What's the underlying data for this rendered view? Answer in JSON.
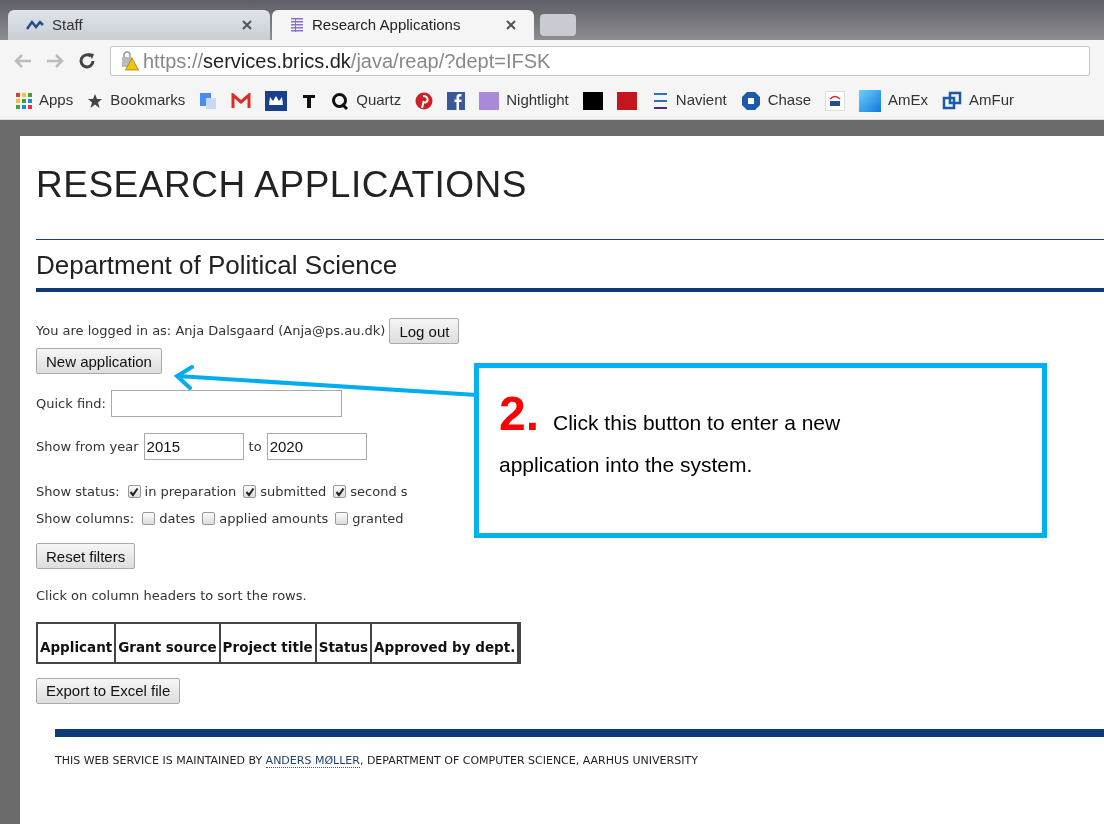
{
  "browser": {
    "tabs": [
      {
        "title": "Staff",
        "selected": false,
        "kind": "wave"
      },
      {
        "title": "Research Applications",
        "selected": true,
        "kind": "grid"
      }
    ],
    "url": {
      "scheme": "https://",
      "host": "services.brics.dk",
      "path": "/java/reap/?dept=IFSK"
    },
    "bookmarks": [
      {
        "label": "Apps",
        "kind": "apps"
      },
      {
        "label": "Bookmarks",
        "kind": "star"
      },
      {
        "kind": "translate"
      },
      {
        "kind": "mail"
      },
      {
        "kind": "crown"
      },
      {
        "kind": "newspaper"
      },
      {
        "label": "Quartz",
        "kind": "q"
      },
      {
        "kind": "pin"
      },
      {
        "kind": "facebook"
      },
      {
        "label": "Nightlight",
        "kind": "purple"
      },
      {
        "kind": "black"
      },
      {
        "kind": "red"
      },
      {
        "label": "Navient",
        "kind": "lines"
      },
      {
        "label": "Chase",
        "kind": "octagon"
      },
      {
        "kind": "white"
      },
      {
        "label": "AmEx",
        "kind": "blue"
      },
      {
        "label": "AmFur",
        "kind": "squares"
      }
    ]
  },
  "page": {
    "title": "RESEARCH APPLICATIONS",
    "subtitle": "Department of Political Science",
    "login_text": "You are logged in as: Anja Dalsgaard (Anja@ps.au.dk)",
    "logout_button": "Log out",
    "new_button": "New application",
    "quick_find": {
      "label": "Quick find:"
    },
    "year_from": {
      "label": "Show from year",
      "value": "2015"
    },
    "year_to": {
      "label": "to",
      "value": "2020"
    },
    "status": {
      "label": "Show status:",
      "options": [
        {
          "label": "in preparation",
          "checked": true
        },
        {
          "label": "submitted",
          "checked": true
        },
        {
          "label": "second s",
          "checked": true
        }
      ]
    },
    "columns": {
      "label": "Show columns:",
      "options": [
        {
          "label": "dates",
          "checked": false
        },
        {
          "label": "applied amounts",
          "checked": false
        },
        {
          "label": "granted",
          "checked": false
        }
      ]
    },
    "reset_button": "Reset filters",
    "sort_hint": "Click on column headers to sort the rows.",
    "table": {
      "columns": [
        "Applicant",
        "Grant source",
        "Project title",
        "Status",
        "Approved by dept."
      ]
    },
    "export_button": "Export to Excel file",
    "footer": {
      "prefix": "THIS WEB SERVICE IS MAINTAINED BY",
      "link": "ANDERS MØLLER",
      "suffix": ", DEPARTMENT OF COMPUTER SCIENCE, AARHUS UNIVERSITY"
    }
  },
  "callout": {
    "number": "2.",
    "lines": [
      "Click this button to enter a new",
      "application into the system."
    ]
  }
}
